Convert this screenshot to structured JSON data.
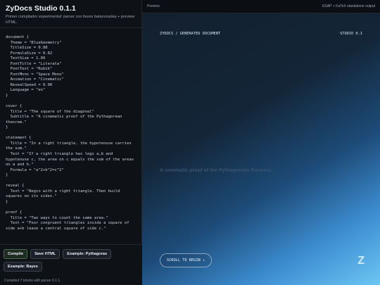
{
  "app": {
    "title": "ZyDocs Studio 0.1.1",
    "subtitle": "Primer compilador experimental: parser con llaves balanceadas + preview HTML."
  },
  "editor_lines": [
    "document {",
    "  Theme = \"BlueGeometry\"",
    "  TitleSize = 0.88",
    "  FormulaSize = 0.82",
    "  TextSize = 1.00",
    "  FontTitle = \"Literata\"",
    "  FontText = \"Rubik\"",
    "  FontMono = \"Space Mono\"",
    "  Animation = \"Cinematic\"",
    "  RevealSpeed = 0.90",
    "  Language = \"en\"",
    "}",
    "",
    "cover {",
    "  Title = \"The square of the diagonal\"",
    "  Subtitle = \"A cinematic proof of the Pythagorean theorem.\"",
    "}",
    "",
    "statement {",
    "  Title = \"In a right triangle, the hypotenuse carries the sum.\"",
    "  Text = \"If a right triangle has legs a,b and hypotenuse c, the area on c equals the sum of the areas on a and b.\"",
    "  Formula = \"a^2+b^2=c^2\"",
    "}",
    "",
    "reveal {",
    "  Text = \"Begin with a right triangle. Then build squares on its sides.\"",
    "}",
    "",
    "proof {",
    "  Title = \"Two ways to count the same area.\"",
    "  Text = \"Four congruent triangles inside a square of side a+b leave a central square of side c.\""
  ],
  "toolbar": {
    "compile_label": "Compile",
    "save_label": "Save HTML",
    "example_pythagoras_label": "Example: Pythagoras",
    "example_bayes_label": "Example: Bayes"
  },
  "status": {
    "text": "Compiled 7 blocks with parser 0.1.1."
  },
  "preview": {
    "label": "Preview",
    "output_label": "GSAP + KaTeX standalone output",
    "header_left": "ZYDOCS / GENERATED DOCUMENT",
    "header_right": "STUDIO 0.1",
    "subtitle": "A cinematic proof of the Pythagorean theorem.",
    "scroll_button": "SCROLL TO BEGIN ↓",
    "logo_letter": "Z"
  },
  "colors": {
    "background": "#0d1117",
    "gradient_end": "#6cc6f2",
    "accent_green": "#4c6a4f"
  }
}
